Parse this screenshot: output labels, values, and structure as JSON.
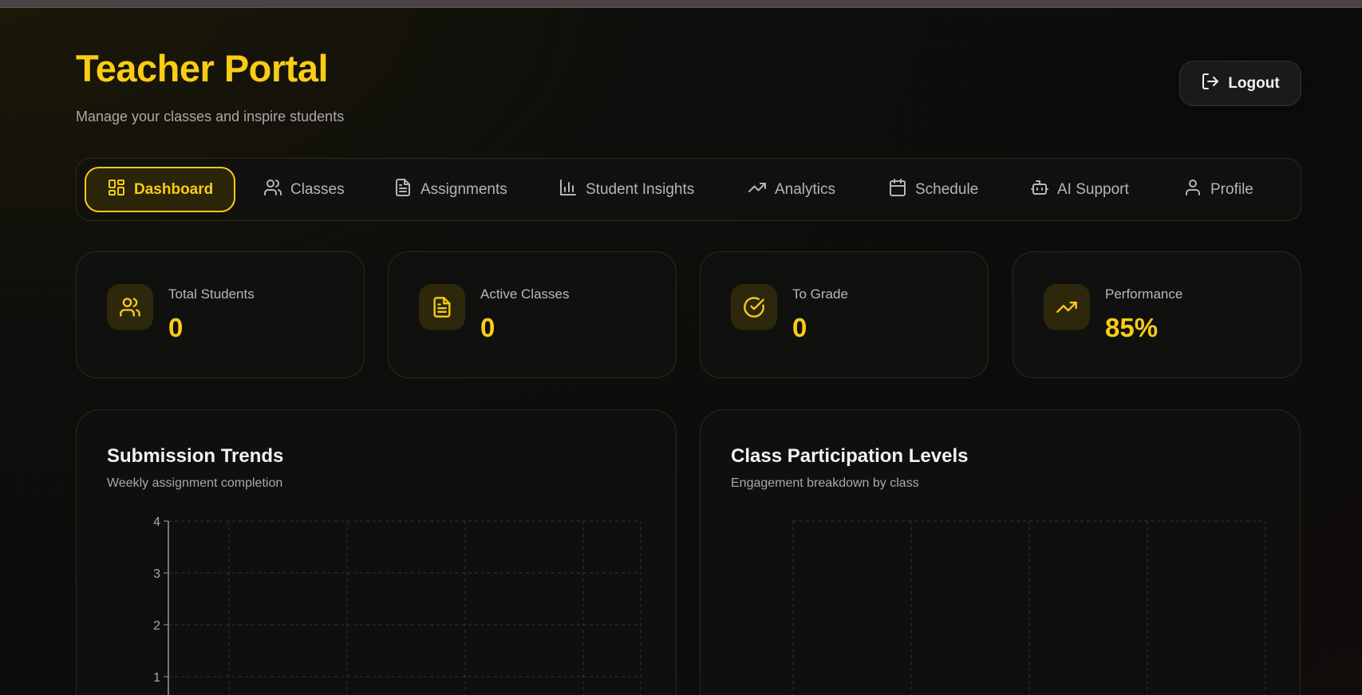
{
  "header": {
    "title": "Teacher Portal",
    "subtitle": "Manage your classes and inspire students",
    "logout_label": "Logout"
  },
  "nav": {
    "items": [
      {
        "label": "Dashboard",
        "icon": "dashboard-icon",
        "active": true
      },
      {
        "label": "Classes",
        "icon": "users-icon",
        "active": false
      },
      {
        "label": "Assignments",
        "icon": "document-icon",
        "active": false
      },
      {
        "label": "Student Insights",
        "icon": "bar-chart-icon",
        "active": false
      },
      {
        "label": "Analytics",
        "icon": "trending-up-icon",
        "active": false
      },
      {
        "label": "Schedule",
        "icon": "calendar-icon",
        "active": false
      },
      {
        "label": "AI Support",
        "icon": "bot-icon",
        "active": false
      },
      {
        "label": "Profile",
        "icon": "user-icon",
        "active": false
      }
    ]
  },
  "stats": [
    {
      "label": "Total Students",
      "value": "0",
      "icon": "users-icon"
    },
    {
      "label": "Active Classes",
      "value": "0",
      "icon": "document-icon"
    },
    {
      "label": "To Grade",
      "value": "0",
      "icon": "check-circle-icon"
    },
    {
      "label": "Performance",
      "value": "85%",
      "icon": "trending-up-icon"
    }
  ],
  "panels": {
    "submission": {
      "title": "Submission Trends",
      "subtitle": "Weekly assignment completion"
    },
    "participation": {
      "title": "Class Participation Levels",
      "subtitle": "Engagement breakdown by class"
    }
  },
  "chart_data": [
    {
      "type": "line",
      "title": "Submission Trends",
      "subtitle": "Weekly assignment completion",
      "y_ticks": [
        "4",
        "3",
        "2",
        "1"
      ],
      "ylim": [
        0,
        4
      ],
      "grid": true,
      "series": []
    },
    {
      "type": "bar",
      "title": "Class Participation Levels",
      "subtitle": "Engagement breakdown by class",
      "grid": true,
      "series": []
    }
  ],
  "colors": {
    "accent": "#facc15",
    "background": "#0e0e0c",
    "card_border": "#2e2b14"
  }
}
